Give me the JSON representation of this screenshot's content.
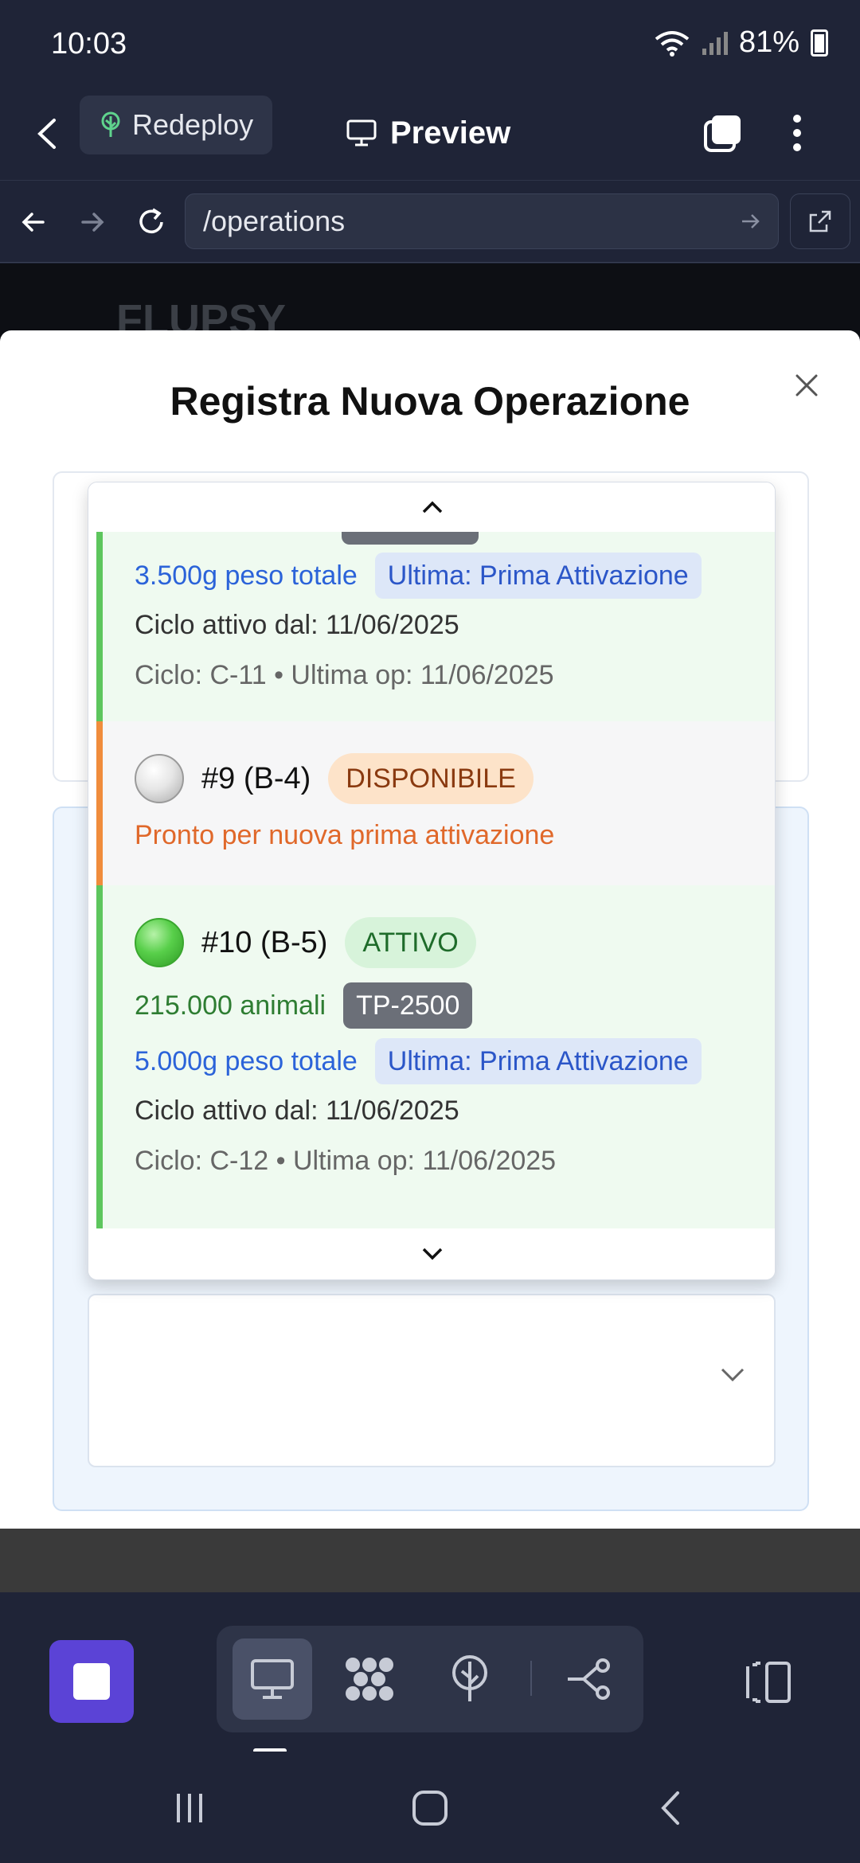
{
  "status": {
    "time": "10:03",
    "battery": "81%"
  },
  "toolbar": {
    "redeploy_label": "Redeploy",
    "preview_label": "Preview"
  },
  "browser": {
    "url": "/operations"
  },
  "page": {
    "brand": "FLUPSY"
  },
  "dialog": {
    "title": "Registra Nuova Operazione",
    "baskets": [
      {
        "weight": "3.500g peso totale",
        "last_op": "Ultima: Prima Attivazione",
        "cycle_start": "Ciclo attivo dal: 11/06/2025",
        "cycle_info": "Ciclo: C-11 • Ultima op: 11/06/2025"
      },
      {
        "title": "#9 (B-4)",
        "status": "DISPONIBILE",
        "message": "Pronto per nuova prima attivazione"
      },
      {
        "title": "#10 (B-5)",
        "status": "ATTIVO",
        "animals": "215.000 animali",
        "size_tag": "TP-2500",
        "weight": "5.000g peso totale",
        "last_op": "Ultima: Prima Attivazione",
        "cycle_start": "Ciclo attivo dal: 11/06/2025",
        "cycle_info": "Ciclo: C-12 • Ultima op: 11/06/2025"
      }
    ]
  },
  "colors": {
    "accent": "#5b43d6",
    "active_border": "#5dc65d",
    "available_border": "#f08c3c"
  },
  "icons": {
    "back": "chevron-left-icon",
    "redeploy": "tree-icon",
    "preview": "monitor-icon",
    "tabs": "tabs-icon",
    "more": "more-vertical-icon",
    "close": "close-icon"
  }
}
